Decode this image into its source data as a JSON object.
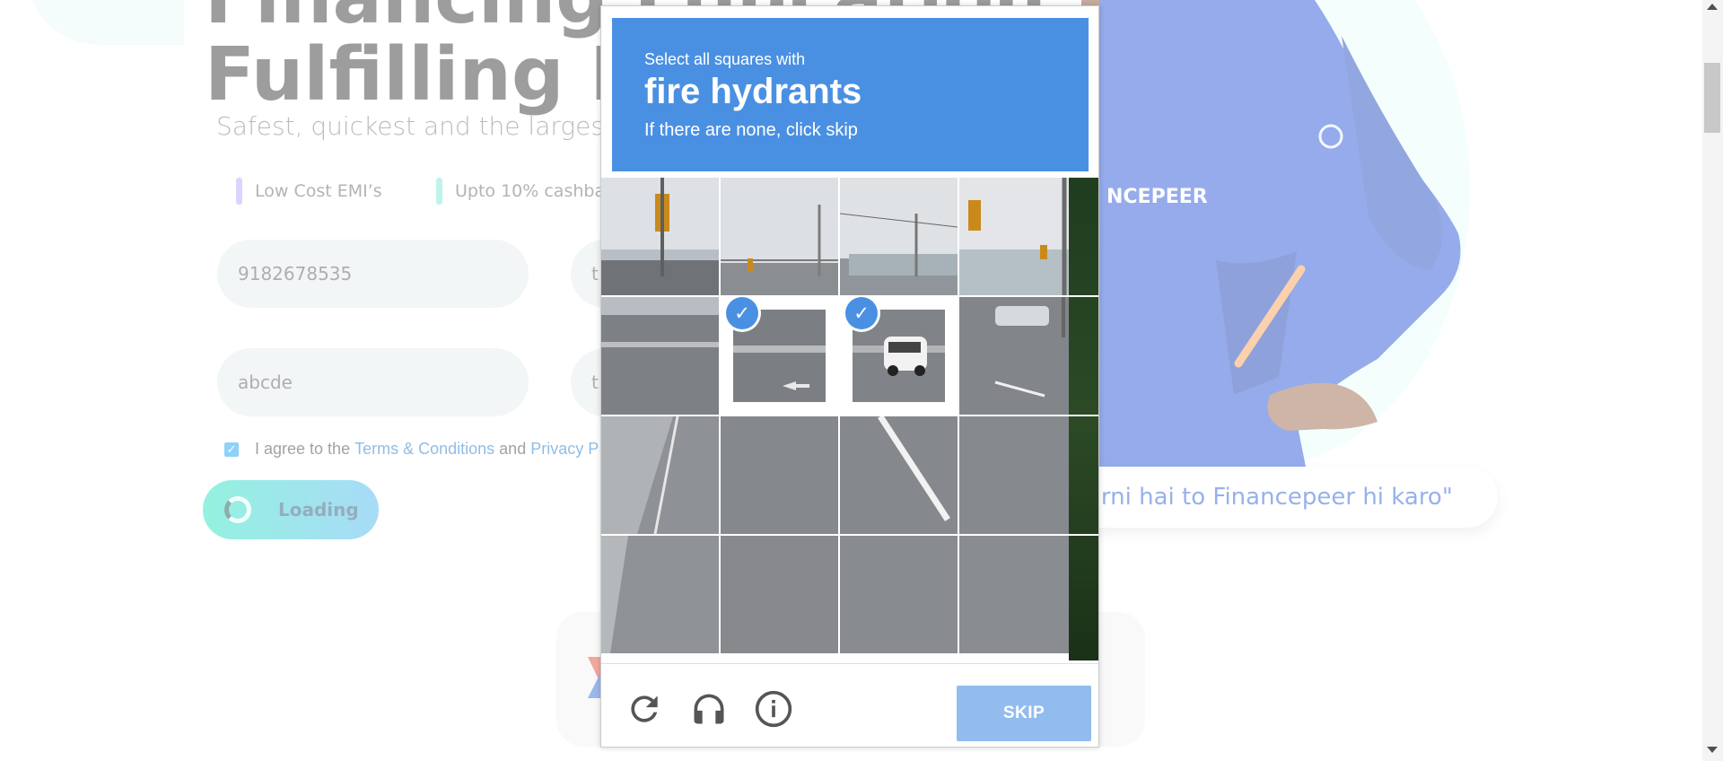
{
  "background": {
    "hero_title": "Financing Education\nFulfilling Dreams",
    "hero_subtitle": "Safest, quickest and the largest edu",
    "features": [
      {
        "label": "Low Cost EMI’s",
        "color": "#b6a8ff"
      },
      {
        "label": "Upto 10% cashbac",
        "color": "#7fe9d3"
      }
    ],
    "form": {
      "phone_value": "9182678535",
      "field2_value": "t",
      "name_value": "abcde",
      "field4_value": "t"
    },
    "agree": {
      "prefix": "I agree to the",
      "terms_link": "Terms & Conditions",
      "joiner": "and",
      "privacy_link": "Privacy P"
    },
    "loading_label": "Loading",
    "brand_text": "NCEPEER",
    "quote": "arni hai to Financepeer hi karo\""
  },
  "captcha": {
    "instruction_line1": "Select all squares with",
    "target_object": "fire hydrants",
    "instruction_line3": "If there are none, click skip",
    "tiles_selected": [
      5,
      6
    ],
    "skip_label": "SKIP",
    "footer_icons": [
      "reload-icon",
      "audio-headphones-icon",
      "info-icon"
    ],
    "accent_color": "#4a90e2"
  }
}
